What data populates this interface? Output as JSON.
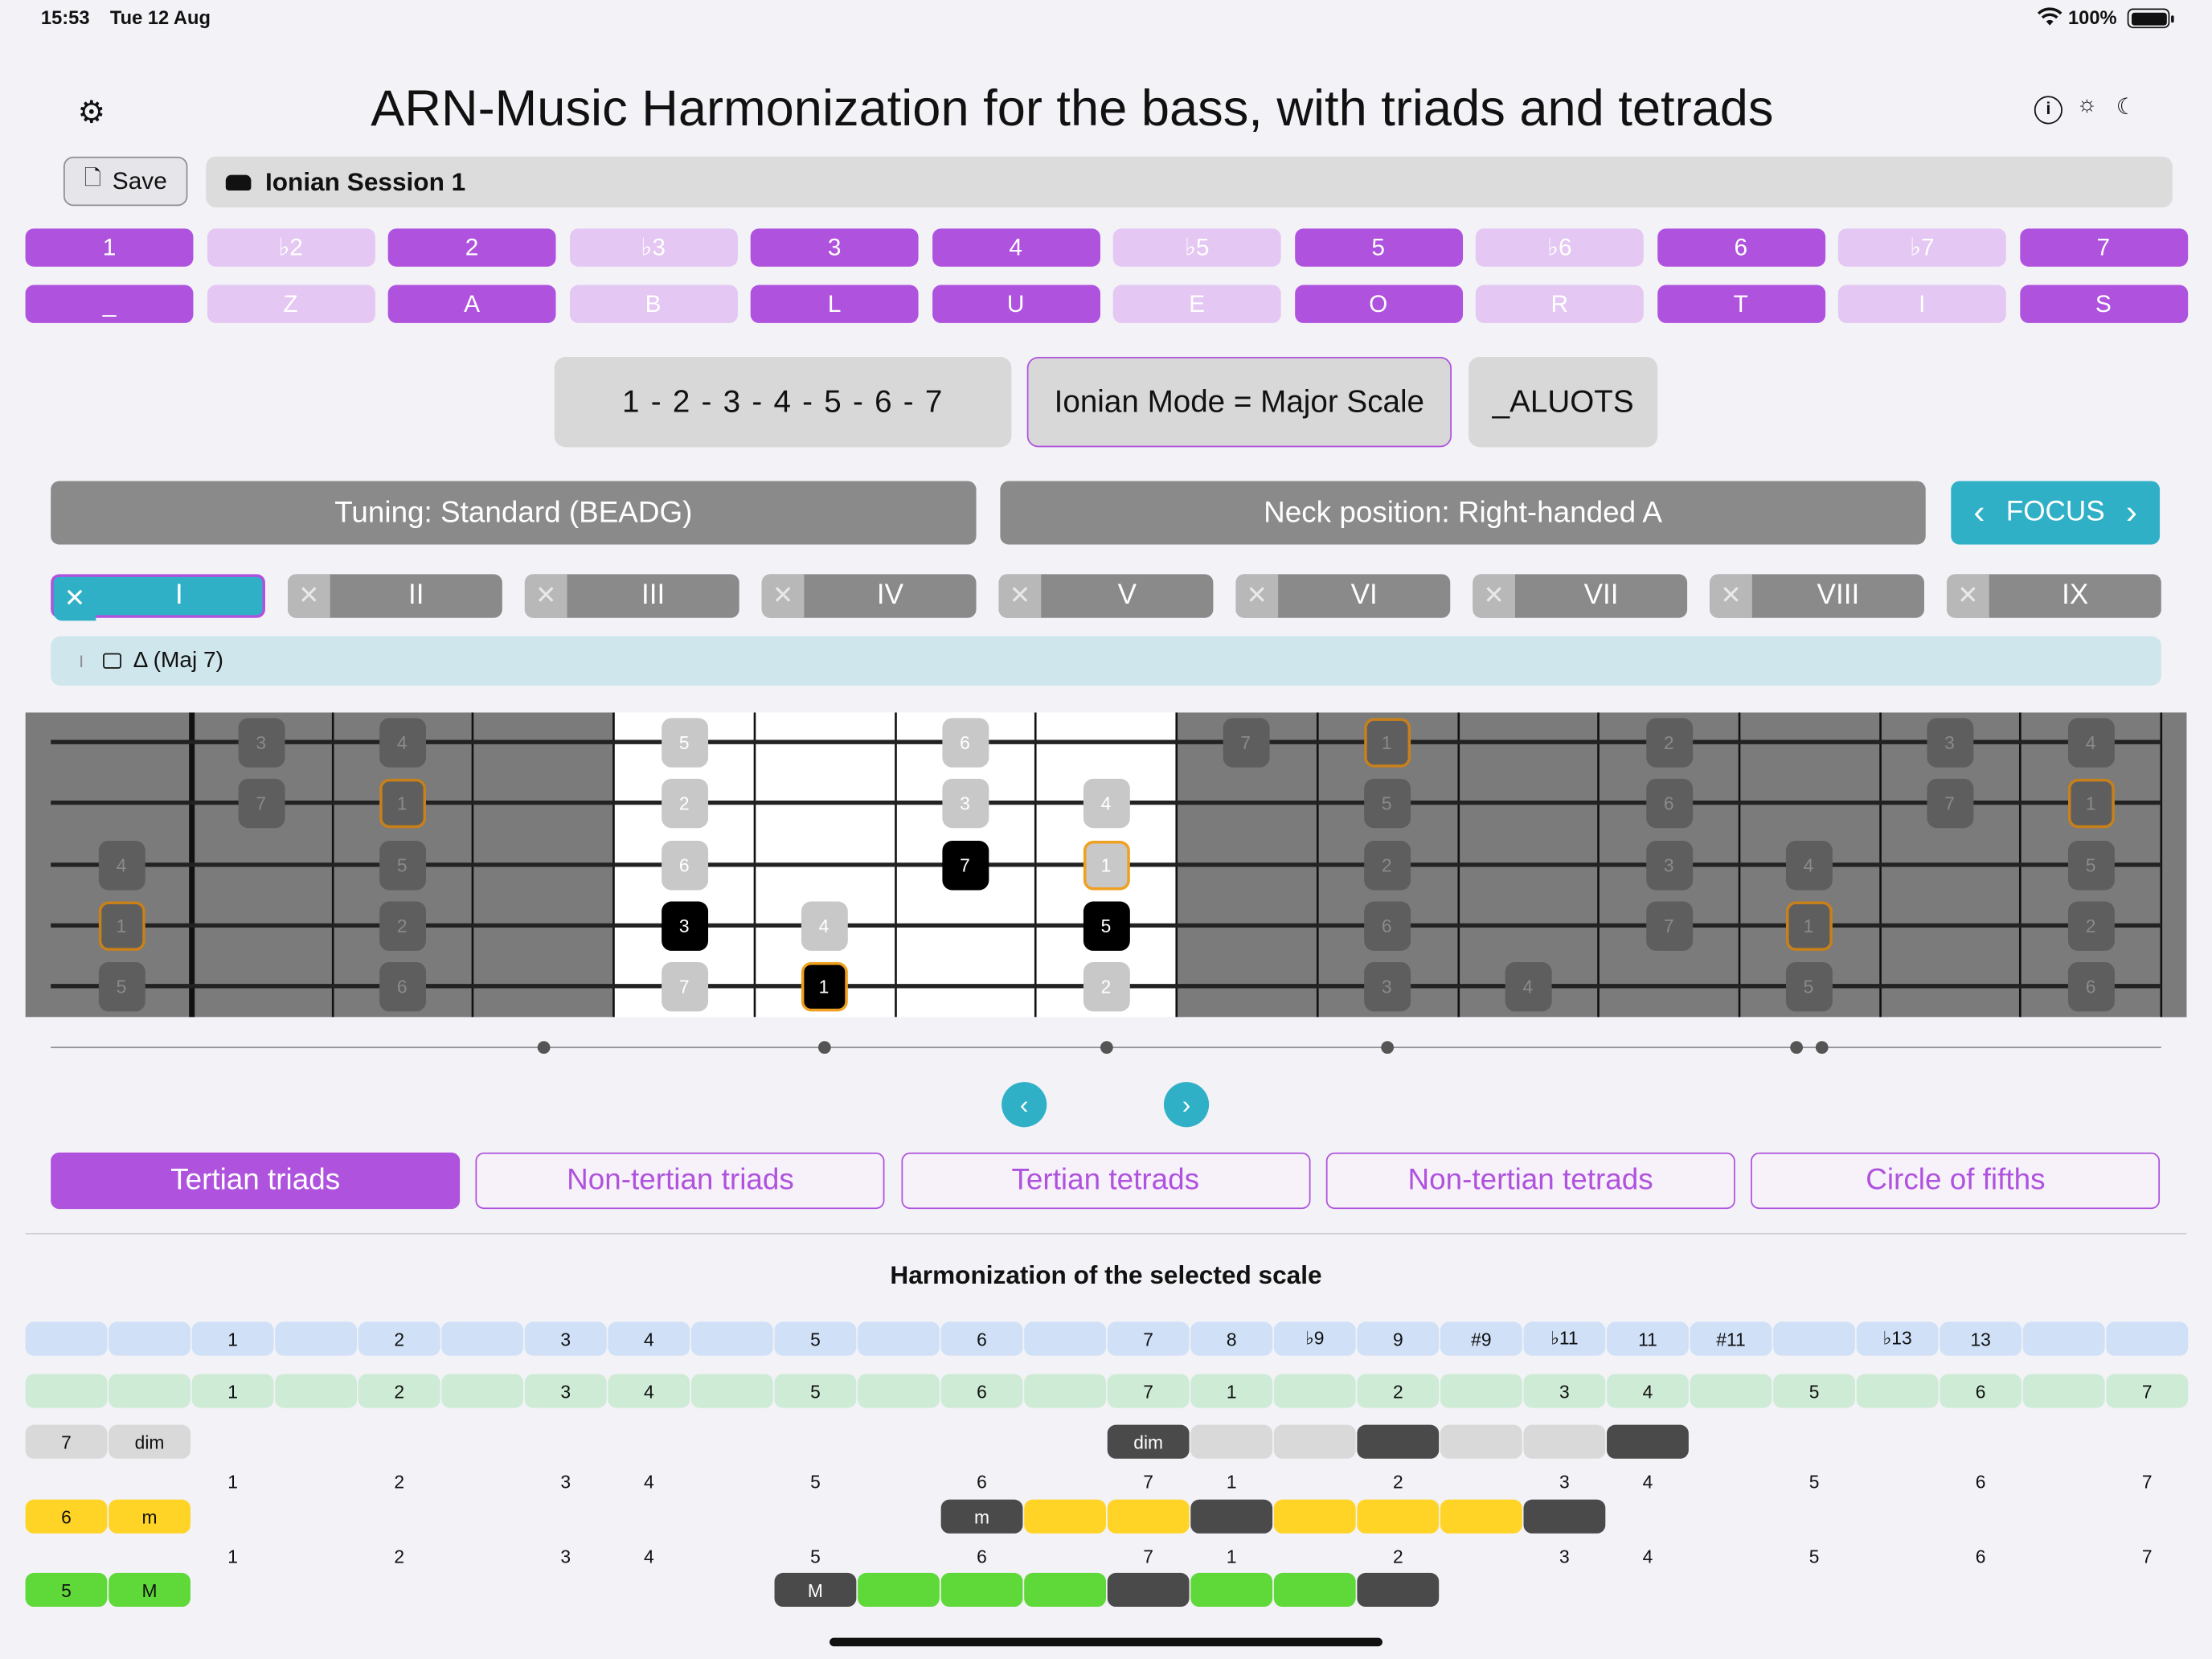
{
  "status": {
    "time": "15:53",
    "date": "Tue 12 Aug",
    "battery": "100%"
  },
  "header": {
    "title": "ARN-Music   Harmonization for the bass, with triads and tetrads",
    "save_label": "Save",
    "session": "Ionian Session 1"
  },
  "degrees": [
    "1",
    "♭2",
    "2",
    "♭3",
    "3",
    "4",
    "♭5",
    "5",
    "♭6",
    "6",
    "♭7",
    "7"
  ],
  "letters": [
    "_",
    "Z",
    "A",
    "B",
    "L",
    "U",
    "E",
    "O",
    "R",
    "T",
    "I",
    "S"
  ],
  "degree_active": [
    true,
    false,
    true,
    false,
    true,
    true,
    false,
    true,
    false,
    true,
    false,
    true
  ],
  "scale": {
    "formula": "1 - 2 - 3 - 4 - 5 - 6 - 7",
    "mode": "Ionian Mode = Major Scale",
    "code": "_ALUOTS"
  },
  "tuning": "Tuning: Standard (BEADG)",
  "neck_position": "Neck position: Right-handed A",
  "focus_label": "FOCUS",
  "positions": [
    "I",
    "II",
    "III",
    "IV",
    "V",
    "VI",
    "VII",
    "VIII",
    "IX"
  ],
  "chord": {
    "position": "I",
    "name": "Δ (Maj 7)"
  },
  "fretboard": {
    "strings": 5,
    "notes": [
      {
        "s": 0,
        "f": 1,
        "t": "3",
        "k": "dim"
      },
      {
        "s": 0,
        "f": 2,
        "t": "4",
        "k": "dim"
      },
      {
        "s": 0,
        "f": 4,
        "t": "5",
        "k": "lt"
      },
      {
        "s": 0,
        "f": 6,
        "t": "6",
        "k": "lt"
      },
      {
        "s": 0,
        "f": 8,
        "t": "7",
        "k": "dim"
      },
      {
        "s": 0,
        "f": 9,
        "t": "1",
        "k": "dimroot"
      },
      {
        "s": 0,
        "f": 11,
        "t": "2",
        "k": "dim"
      },
      {
        "s": 0,
        "f": 13,
        "t": "3",
        "k": "dim"
      },
      {
        "s": 0,
        "f": 14,
        "t": "4",
        "k": "dim"
      },
      {
        "s": 1,
        "f": 1,
        "t": "7",
        "k": "dim"
      },
      {
        "s": 1,
        "f": 2,
        "t": "1",
        "k": "dimroot"
      },
      {
        "s": 1,
        "f": 4,
        "t": "2",
        "k": "lt"
      },
      {
        "s": 1,
        "f": 6,
        "t": "3",
        "k": "lt"
      },
      {
        "s": 1,
        "f": 7,
        "t": "4",
        "k": "lt"
      },
      {
        "s": 1,
        "f": 9,
        "t": "5",
        "k": "dim"
      },
      {
        "s": 1,
        "f": 11,
        "t": "6",
        "k": "dim"
      },
      {
        "s": 1,
        "f": 13,
        "t": "7",
        "k": "dim"
      },
      {
        "s": 1,
        "f": 14,
        "t": "1",
        "k": "dimroot"
      },
      {
        "s": 2,
        "f": 0,
        "t": "4",
        "k": "dim"
      },
      {
        "s": 2,
        "f": 2,
        "t": "5",
        "k": "dim"
      },
      {
        "s": 2,
        "f": 4,
        "t": "6",
        "k": "lt"
      },
      {
        "s": 2,
        "f": 6,
        "t": "7",
        "k": "blk"
      },
      {
        "s": 2,
        "f": 7,
        "t": "1",
        "k": "ltroot"
      },
      {
        "s": 2,
        "f": 9,
        "t": "2",
        "k": "dim"
      },
      {
        "s": 2,
        "f": 11,
        "t": "3",
        "k": "dim"
      },
      {
        "s": 2,
        "f": 12,
        "t": "4",
        "k": "dim"
      },
      {
        "s": 2,
        "f": 14,
        "t": "5",
        "k": "dim"
      },
      {
        "s": 3,
        "f": 0,
        "t": "1",
        "k": "dimroot"
      },
      {
        "s": 3,
        "f": 2,
        "t": "2",
        "k": "dim"
      },
      {
        "s": 3,
        "f": 4,
        "t": "3",
        "k": "blk"
      },
      {
        "s": 3,
        "f": 5,
        "t": "4",
        "k": "lt"
      },
      {
        "s": 3,
        "f": 7,
        "t": "5",
        "k": "blk"
      },
      {
        "s": 3,
        "f": 9,
        "t": "6",
        "k": "dim"
      },
      {
        "s": 3,
        "f": 11,
        "t": "7",
        "k": "dim"
      },
      {
        "s": 3,
        "f": 12,
        "t": "1",
        "k": "dimroot"
      },
      {
        "s": 3,
        "f": 14,
        "t": "2",
        "k": "dim"
      },
      {
        "s": 4,
        "f": 0,
        "t": "5",
        "k": "dim"
      },
      {
        "s": 4,
        "f": 2,
        "t": "6",
        "k": "dim"
      },
      {
        "s": 4,
        "f": 4,
        "t": "7",
        "k": "lt"
      },
      {
        "s": 4,
        "f": 5,
        "t": "1",
        "k": "blkroot"
      },
      {
        "s": 4,
        "f": 7,
        "t": "2",
        "k": "lt"
      },
      {
        "s": 4,
        "f": 9,
        "t": "3",
        "k": "dim"
      },
      {
        "s": 4,
        "f": 10,
        "t": "4",
        "k": "dim"
      },
      {
        "s": 4,
        "f": 12,
        "t": "5",
        "k": "dim"
      },
      {
        "s": 4,
        "f": 14,
        "t": "6",
        "k": "dim"
      }
    ]
  },
  "tabs": [
    "Tertian triads",
    "Non-tertian triads",
    "Tertian tetrads",
    "Non-tertian tetrads",
    "Circle of fifths"
  ],
  "harmonization": {
    "title": "Harmonization of the selected scale",
    "row_blue": [
      "",
      "",
      "1",
      "",
      "2",
      "",
      "3",
      "4",
      "",
      "5",
      "",
      "6",
      "",
      "7",
      "8",
      "♭9",
      "9",
      "#9",
      "♭11",
      "11",
      "#11",
      "",
      "♭13",
      "13",
      "",
      ""
    ],
    "row_green": [
      "",
      "",
      "1",
      "",
      "2",
      "",
      "3",
      "4",
      "",
      "5",
      "",
      "6",
      "",
      "7",
      "1",
      "",
      "2",
      "",
      "3",
      "4",
      "",
      "5",
      "",
      "6",
      "",
      "7"
    ],
    "interval_numbers": [
      "",
      "",
      "1",
      "",
      "2",
      "",
      "3",
      "4",
      "",
      "5",
      "",
      "6",
      "",
      "7",
      "1",
      "",
      "2",
      "",
      "3",
      "4",
      "",
      "5",
      "",
      "6",
      "",
      "7"
    ],
    "rows": [
      {
        "deg": "7",
        "quality": "dim",
        "color": "#d9d9d9",
        "start": 13,
        "label": "dim",
        "pattern": [
          "s",
          "l",
          "l",
          "d",
          "l",
          "l",
          "d"
        ]
      },
      {
        "deg": "6",
        "quality": "m",
        "color": "#ffd426",
        "start": 11,
        "label": "m",
        "pattern": [
          "s",
          "y",
          "y",
          "d",
          "y",
          "y",
          "y",
          "d"
        ]
      },
      {
        "deg": "5",
        "quality": "M",
        "color": "#5fd93a",
        "start": 9,
        "label": "M",
        "pattern": [
          "s",
          "g",
          "g",
          "g",
          "d",
          "g",
          "g",
          "d"
        ]
      }
    ]
  }
}
